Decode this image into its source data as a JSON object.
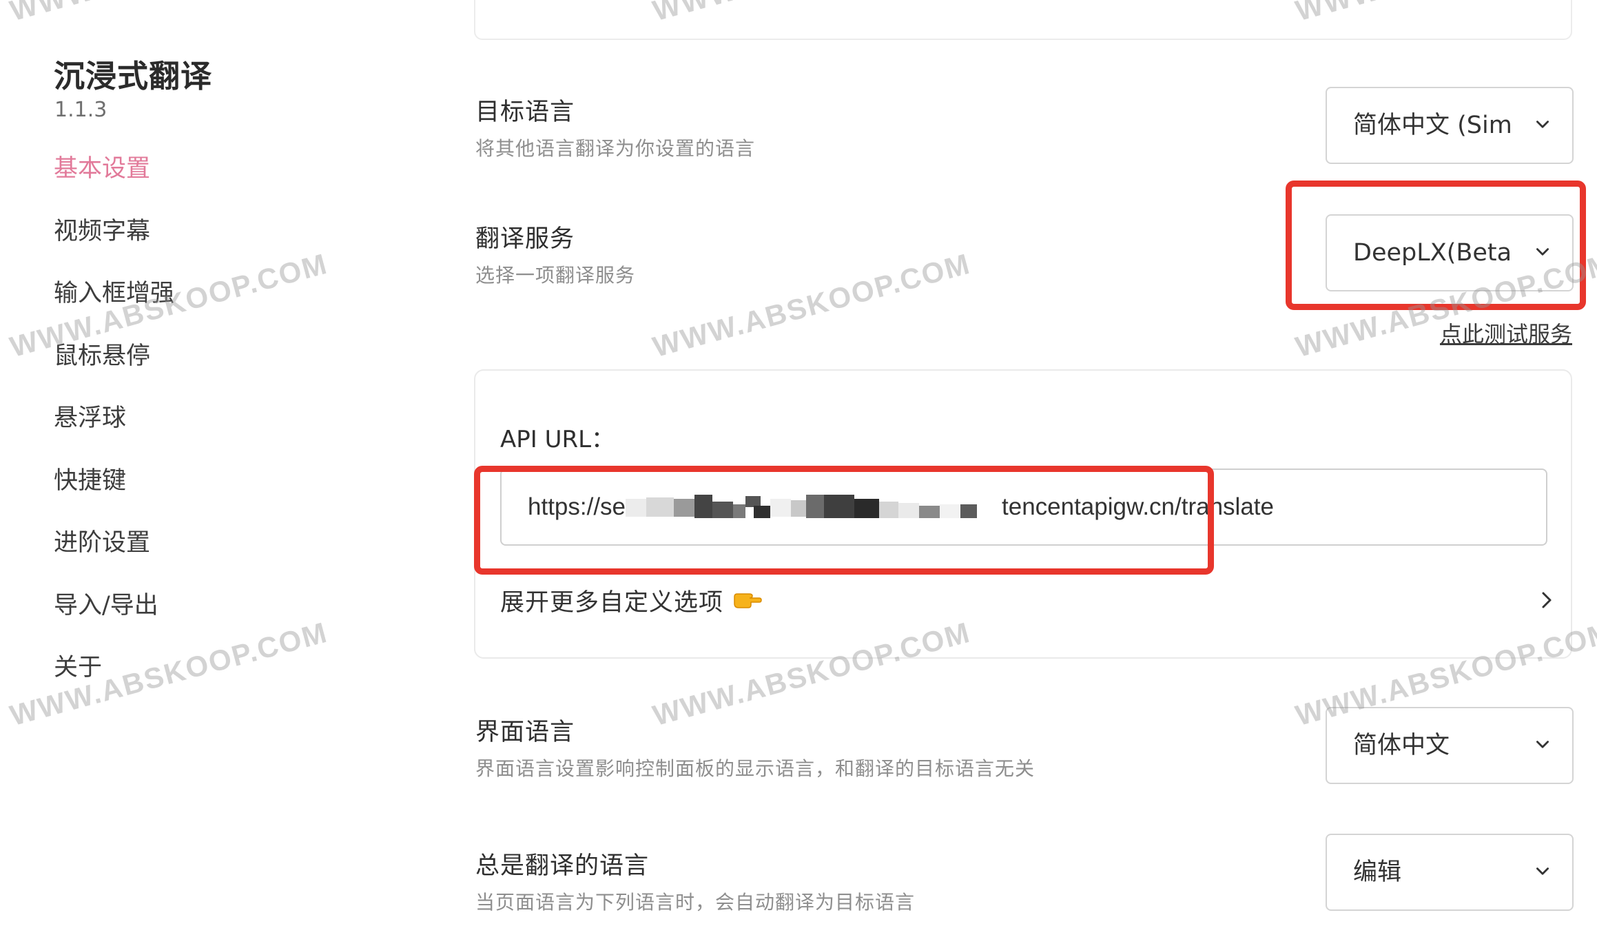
{
  "app": {
    "title": "沉浸式翻译",
    "version": "1.1.3"
  },
  "sidebar": {
    "items": [
      {
        "label": "基本设置",
        "active": true
      },
      {
        "label": "视频字幕"
      },
      {
        "label": "输入框增强"
      },
      {
        "label": "鼠标悬停"
      },
      {
        "label": "悬浮球"
      },
      {
        "label": "快捷键"
      },
      {
        "label": "进阶设置"
      },
      {
        "label": "导入/导出"
      },
      {
        "label": "关于"
      }
    ]
  },
  "settings": {
    "target_language": {
      "label": "目标语言",
      "description": "将其他语言翻译为你设置的语言",
      "value": "简体中文 (Simp"
    },
    "translation_service": {
      "label": "翻译服务",
      "description": "选择一项翻译服务",
      "value": "DeepLX(Beta)",
      "test_link": "点此测试服务"
    },
    "api": {
      "label": "API URL：",
      "url_prefix": "https://serv",
      "url_suffix": "tencentapigw.cn/translate",
      "expand_label": "展开更多自定义选项"
    },
    "ui_language": {
      "label": "界面语言",
      "description": "界面语言设置影响控制面板的显示语言，和翻译的目标语言无关",
      "value": "简体中文"
    },
    "always_translate": {
      "label": "总是翻译的语言",
      "description": "当页面语言为下列语言时，会自动翻译为目标语言",
      "value": "编辑"
    }
  },
  "watermark": {
    "text": "WWW.ABSKOOP.COM"
  },
  "colors": {
    "active_nav": "#e27a9a",
    "highlight": "#e8362c"
  }
}
